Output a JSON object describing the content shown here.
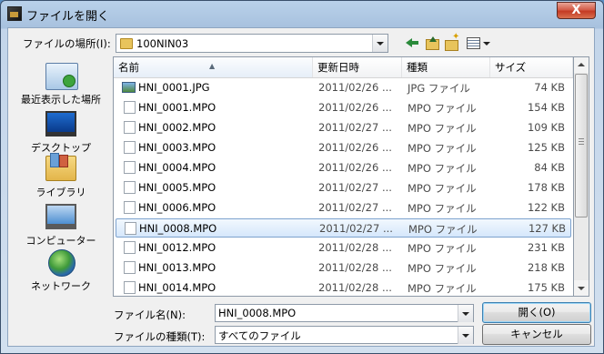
{
  "window": {
    "title": "ファイルを開く",
    "close_glyph": "X"
  },
  "lookin": {
    "label": "ファイルの場所(I):",
    "value": "100NIN03"
  },
  "places": [
    {
      "label": "最近表示した場所",
      "icon": "recent-places-icon"
    },
    {
      "label": "デスクトップ",
      "icon": "desktop-icon"
    },
    {
      "label": "ライブラリ",
      "icon": "libraries-icon"
    },
    {
      "label": "コンピューター",
      "icon": "computer-icon"
    },
    {
      "label": "ネットワーク",
      "icon": "network-icon"
    }
  ],
  "columns": {
    "name": "名前",
    "date": "更新日時",
    "type": "種類",
    "size": "サイズ"
  },
  "files": [
    {
      "name": "HNI_0001.JPG",
      "date": "2011/02/26 ...",
      "type": "JPG ファイル",
      "size": "74 KB",
      "icon": "image-file-icon"
    },
    {
      "name": "HNI_0001.MPO",
      "date": "2011/02/26 ...",
      "type": "MPO ファイル",
      "size": "154 KB",
      "icon": "file-icon"
    },
    {
      "name": "HNI_0002.MPO",
      "date": "2011/02/27 ...",
      "type": "MPO ファイル",
      "size": "109 KB",
      "icon": "file-icon"
    },
    {
      "name": "HNI_0003.MPO",
      "date": "2011/02/26 ...",
      "type": "MPO ファイル",
      "size": "125 KB",
      "icon": "file-icon"
    },
    {
      "name": "HNI_0004.MPO",
      "date": "2011/02/26 ...",
      "type": "MPO ファイル",
      "size": "84 KB",
      "icon": "file-icon"
    },
    {
      "name": "HNI_0005.MPO",
      "date": "2011/02/27 ...",
      "type": "MPO ファイル",
      "size": "178 KB",
      "icon": "file-icon"
    },
    {
      "name": "HNI_0006.MPO",
      "date": "2011/02/27 ...",
      "type": "MPO ファイル",
      "size": "122 KB",
      "icon": "file-icon"
    },
    {
      "name": "HNI_0008.MPO",
      "date": "2011/02/27 ...",
      "type": "MPO ファイル",
      "size": "127 KB",
      "icon": "file-icon",
      "selected": true
    },
    {
      "name": "HNI_0012.MPO",
      "date": "2011/02/28 ...",
      "type": "MPO ファイル",
      "size": "231 KB",
      "icon": "file-icon"
    },
    {
      "name": "HNI_0013.MPO",
      "date": "2011/02/28 ...",
      "type": "MPO ファイル",
      "size": "218 KB",
      "icon": "file-icon"
    },
    {
      "name": "HNI_0014.MPO",
      "date": "2011/02/28 ...",
      "type": "MPO ファイル",
      "size": "175 KB",
      "icon": "file-icon"
    }
  ],
  "filename": {
    "label": "ファイル名(N):",
    "value": "HNI_0008.MPO"
  },
  "filetype": {
    "label": "ファイルの種類(T):",
    "value": "すべてのファイル"
  },
  "buttons": {
    "open": "開く(O)",
    "cancel": "キャンセル"
  },
  "colors": {
    "selection": "#d5e7fb",
    "selection_border": "#7da2ce",
    "title_gradient": "#b9d1ea"
  }
}
